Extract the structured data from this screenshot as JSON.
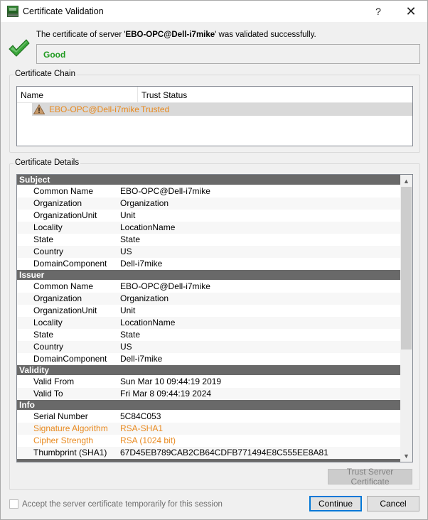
{
  "window": {
    "title": "Certificate Validation",
    "help_label": "?",
    "close_label": "✕"
  },
  "header": {
    "message_prefix": "The certificate of server '",
    "server_name": "EBO-OPC@Dell-i7mike",
    "message_suffix": "' was validated successfully.",
    "status": "Good",
    "status_color": "#1f9a1f"
  },
  "chain": {
    "title": "Certificate Chain",
    "columns": [
      "Name",
      "Trust Status"
    ],
    "rows": [
      {
        "name": "EBO-OPC@Dell-i7mike",
        "status": "Trusted",
        "icon": "warning-icon"
      }
    ],
    "warning_color": "#e8891e"
  },
  "details": {
    "title": "Certificate Details",
    "sections": [
      {
        "name": "Subject",
        "rows": [
          {
            "key": "Common Name",
            "value": "EBO-OPC@Dell-i7mike"
          },
          {
            "key": "Organization",
            "value": "Organization"
          },
          {
            "key": "OrganizationUnit",
            "value": "Unit"
          },
          {
            "key": "Locality",
            "value": "LocationName"
          },
          {
            "key": "State",
            "value": "State"
          },
          {
            "key": "Country",
            "value": "US"
          },
          {
            "key": "DomainComponent",
            "value": "Dell-i7mike"
          }
        ]
      },
      {
        "name": "Issuer",
        "rows": [
          {
            "key": "Common Name",
            "value": "EBO-OPC@Dell-i7mike"
          },
          {
            "key": "Organization",
            "value": "Organization"
          },
          {
            "key": "OrganizationUnit",
            "value": "Unit"
          },
          {
            "key": "Locality",
            "value": "LocationName"
          },
          {
            "key": "State",
            "value": "State"
          },
          {
            "key": "Country",
            "value": "US"
          },
          {
            "key": "DomainComponent",
            "value": "Dell-i7mike"
          }
        ]
      },
      {
        "name": "Validity",
        "rows": [
          {
            "key": "Valid From",
            "value": "Sun Mar 10 09:44:19 2019"
          },
          {
            "key": "Valid To",
            "value": "Fri Mar 8 09:44:19 2024"
          }
        ]
      },
      {
        "name": "Info",
        "rows": [
          {
            "key": "Serial Number",
            "value": "5C84C053"
          },
          {
            "key": "Signature Algorithm",
            "value": "RSA-SHA1",
            "warn": true
          },
          {
            "key": "Cipher Strength",
            "value": "RSA (1024 bit)",
            "warn": true
          },
          {
            "key": "Thumbprint (SHA1)",
            "value": "67D45EB789CAB2CB64CDFB771494E8C555EE8A81"
          }
        ]
      }
    ]
  },
  "buttons": {
    "trust": "Trust Server Certificate",
    "continue": "Continue",
    "cancel": "Cancel"
  },
  "accept": {
    "label": "Accept the server certificate temporarily for this session",
    "checked": false
  }
}
